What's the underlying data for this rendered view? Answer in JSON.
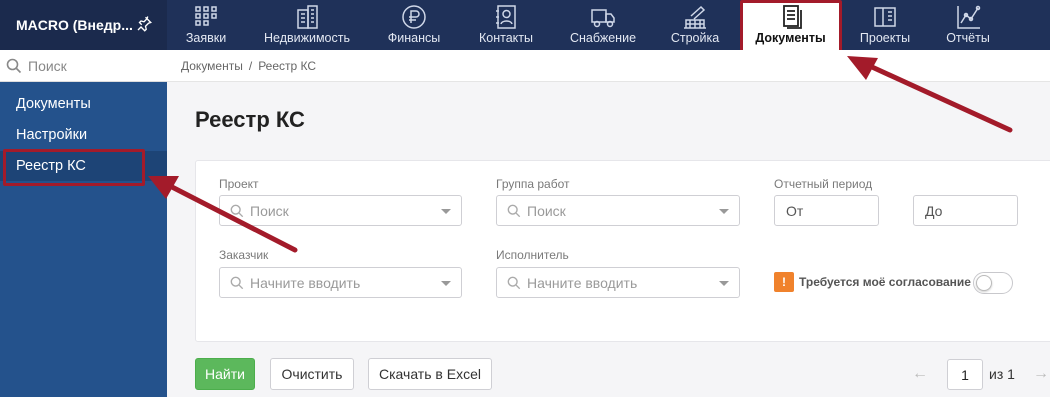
{
  "app": {
    "title": "MACRO (Внедр..."
  },
  "topnav": [
    {
      "label": "Заявки",
      "icon": "requests-grid-icon"
    },
    {
      "label": "Недвижимость",
      "icon": "building-icon"
    },
    {
      "label": "Финансы",
      "icon": "ruble-icon"
    },
    {
      "label": "Контакты",
      "icon": "contacts-book-icon"
    },
    {
      "label": "Снабжение",
      "icon": "truck-icon"
    },
    {
      "label": "Стройка",
      "icon": "construction-icon"
    },
    {
      "label": "Документы",
      "icon": "document-icon",
      "active": true
    },
    {
      "label": "Проекты",
      "icon": "projects-icon"
    },
    {
      "label": "Отчёты",
      "icon": "chart-icon"
    }
  ],
  "sidebar": {
    "search_placeholder": "Поиск",
    "items": [
      {
        "label": "Документы"
      },
      {
        "label": "Настройки"
      },
      {
        "label": "Реестр КС",
        "active": true
      }
    ]
  },
  "breadcrumb": {
    "items": [
      "Документы",
      "Реестр КС"
    ],
    "separator": "/"
  },
  "page": {
    "title": "Реестр КС"
  },
  "filters": {
    "project": {
      "label": "Проект",
      "placeholder": "Поиск"
    },
    "work_group": {
      "label": "Группа работ",
      "placeholder": "Поиск"
    },
    "period": {
      "label": "Отчетный период",
      "from_placeholder": "От",
      "to_placeholder": "До"
    },
    "customer": {
      "label": "Заказчик",
      "placeholder": "Начните вводить"
    },
    "contractor": {
      "label": "Исполнитель",
      "placeholder": "Начните вводить"
    },
    "approval": {
      "badge": "!",
      "label": "Требуется моё согласование",
      "enabled": false
    }
  },
  "actions": {
    "find": "Найти",
    "clear": "Очистить",
    "excel": "Скачать в Excel"
  },
  "pager": {
    "prev": "←",
    "page": "1",
    "of": "из 1",
    "next": "→"
  },
  "colors": {
    "topbar": "#1f3159",
    "sidebar": "#24528c",
    "accent_green": "#5cb85c",
    "highlight": "#a31b2a",
    "badge": "#f0822c"
  }
}
